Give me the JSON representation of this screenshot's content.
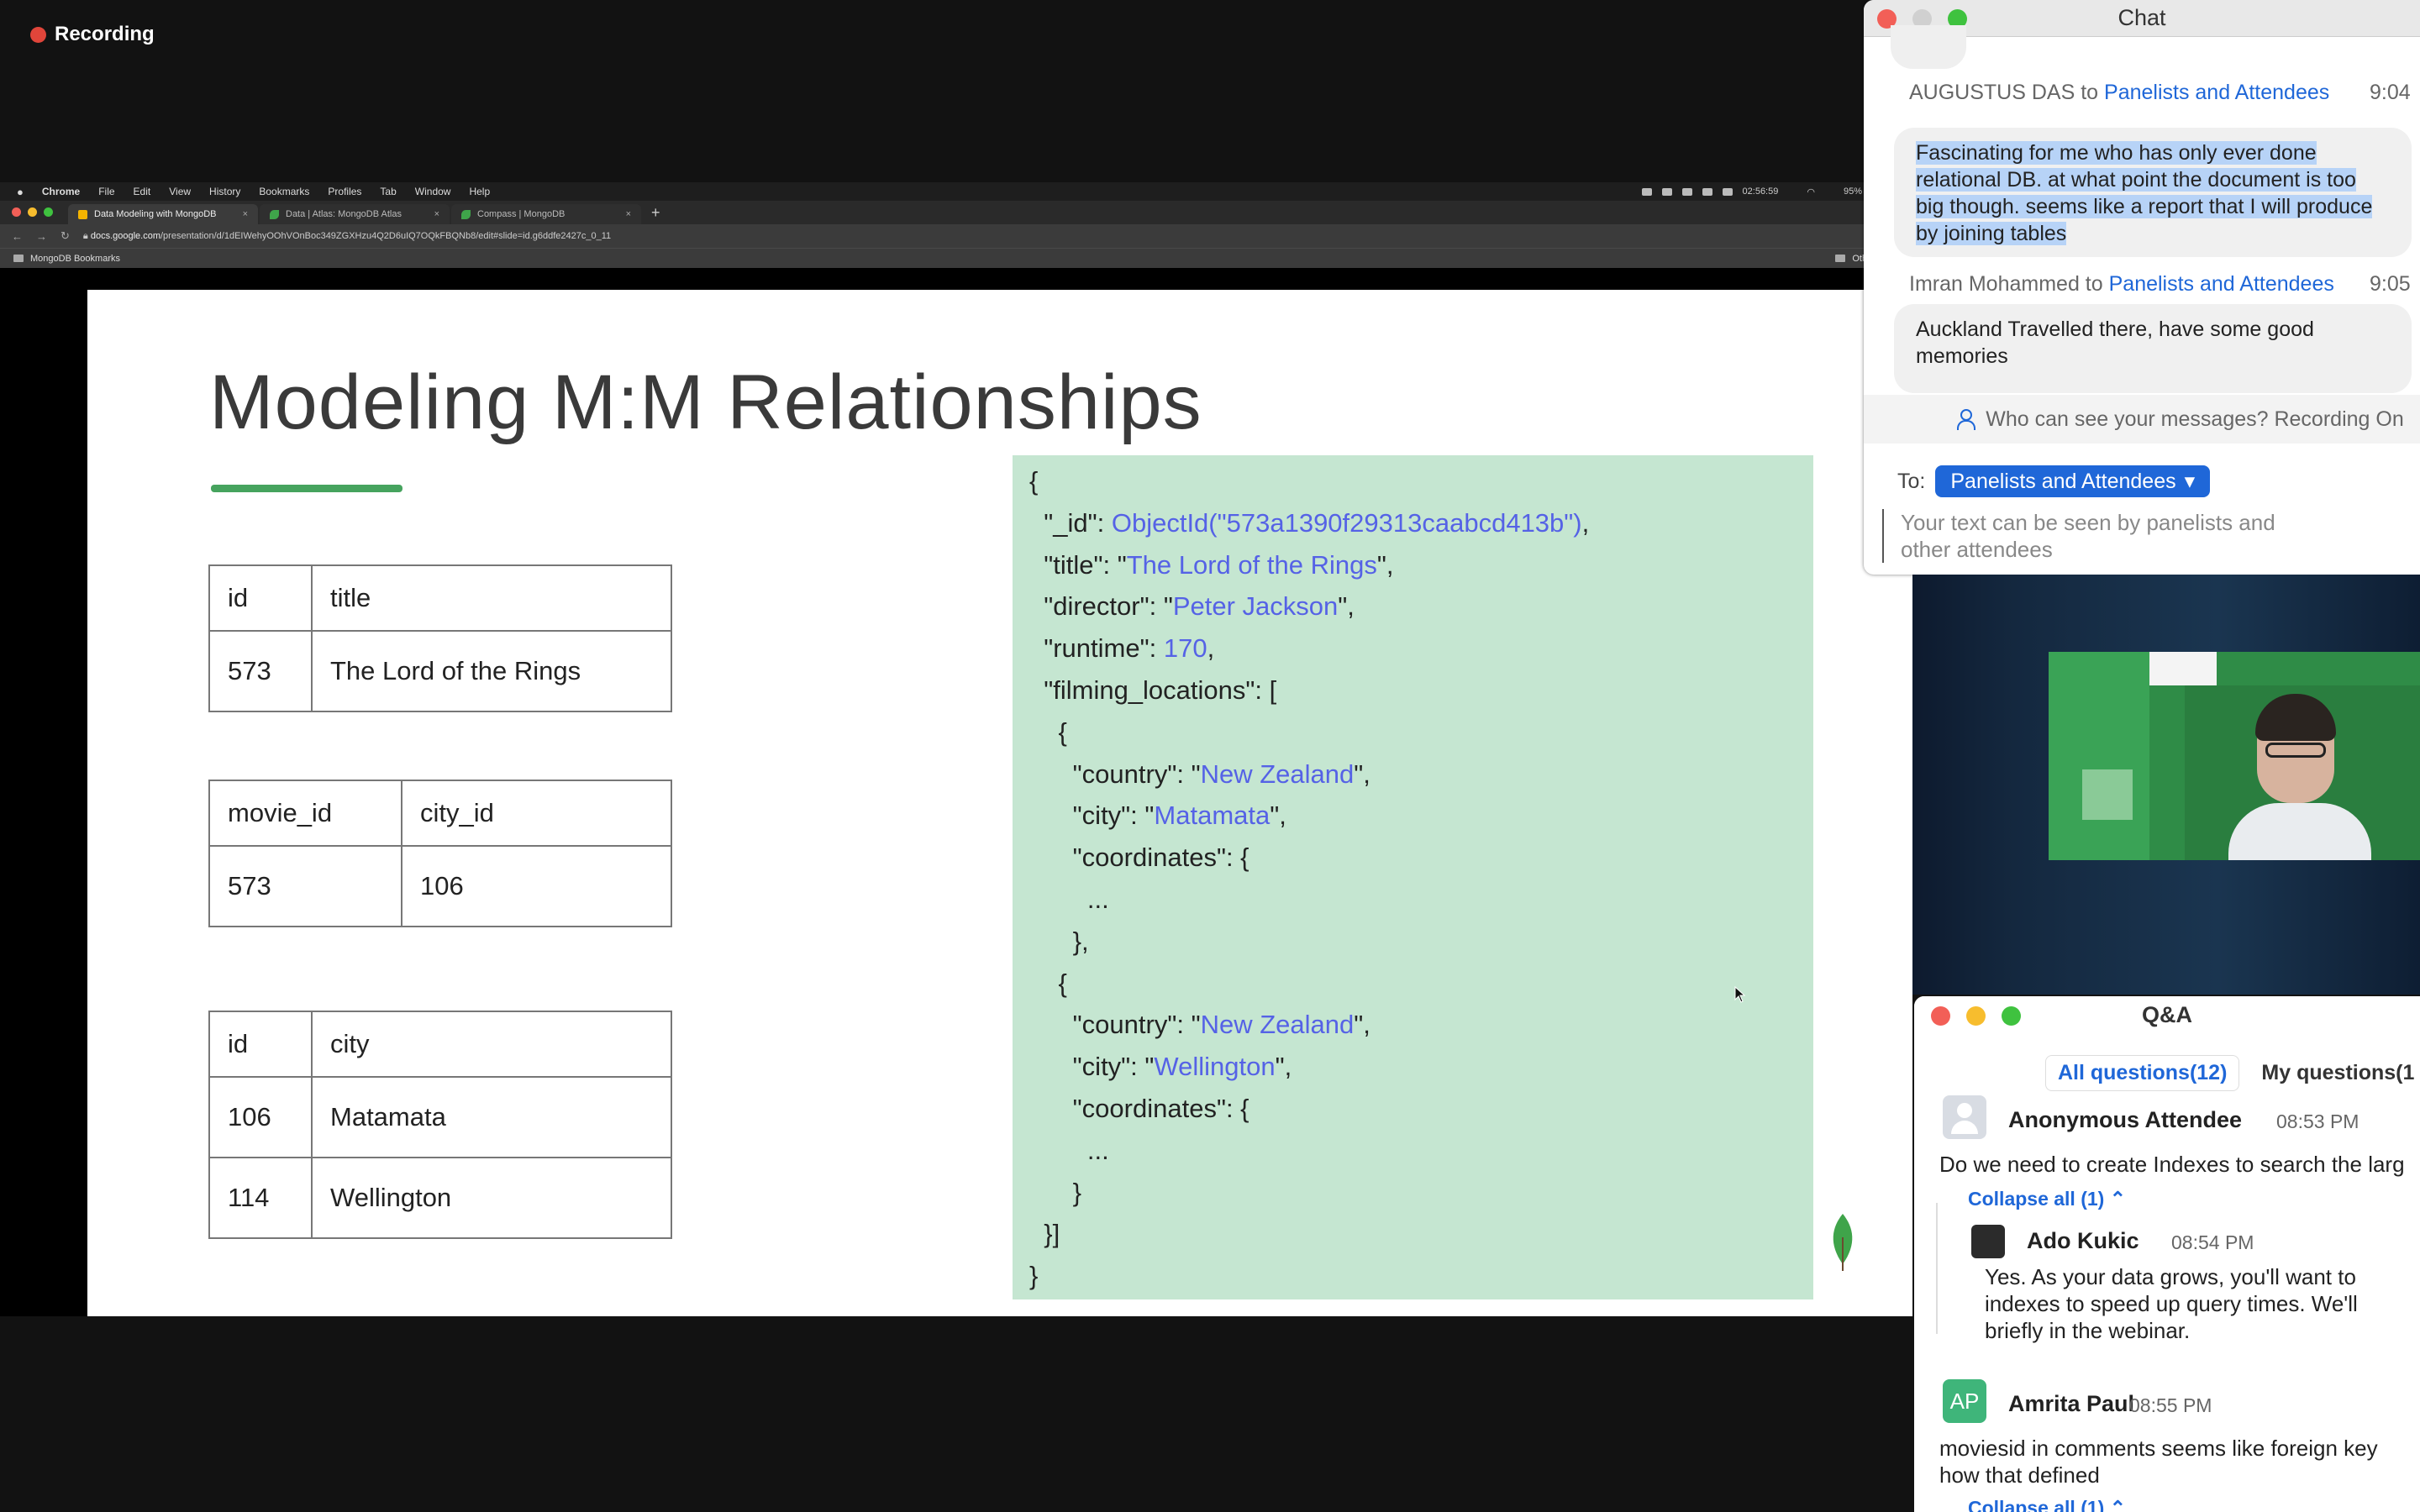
{
  "recording": {
    "label": "Recording"
  },
  "mac_menu": {
    "app": "Chrome",
    "items": [
      "File",
      "Edit",
      "View",
      "History",
      "Bookmarks",
      "Profiles",
      "Tab",
      "Window",
      "Help"
    ],
    "clock": "02:56:59",
    "battery": "95%"
  },
  "browser": {
    "tabs": [
      {
        "label": "Data Modeling with MongoDB"
      },
      {
        "label": "Data | Atlas: MongoDB Atlas"
      },
      {
        "label": "Compass | MongoDB"
      }
    ],
    "new_tab": "+",
    "url_host": "docs.google.com",
    "url_path": "/presentation/d/1dEIWehyOOhVOnBoc349ZGXHzu4Q2D6uIQ7OQkFBQNb8/edit#slide=id.g6ddfe2427c_0_11",
    "bookmark": "MongoDB Bookmarks",
    "other_bookmarks": "Other Book"
  },
  "slide": {
    "title": "Modeling M:M Relationships",
    "tables": [
      {
        "headers": [
          "id",
          "title"
        ],
        "rows": [
          [
            "573",
            "The Lord of the Rings"
          ]
        ]
      },
      {
        "headers": [
          "movie_id",
          "city_id"
        ],
        "rows": [
          [
            "573",
            "106"
          ]
        ]
      },
      {
        "headers": [
          "id",
          "city"
        ],
        "rows": [
          [
            "106",
            "Matamata"
          ],
          [
            "114",
            "Wellington"
          ]
        ]
      }
    ],
    "json": {
      "open": "{",
      "id_key": "  \"_id\": ",
      "id_val": "ObjectId(\"573a1390f29313caabcd413b\")",
      "title_key": "  \"title\": \"",
      "title_val": "The Lord of the Rings",
      "director_key": "  \"director\": \"",
      "director_val": "Peter Jackson",
      "runtime_key": "  \"runtime\": ",
      "runtime_val": "170",
      "locations_key": "  \"filming_locations\": [",
      "brace_open": "    {",
      "country_key": "      \"country\": \"",
      "country_val": "New Zealand",
      "city_key": "      \"city\": \"",
      "city1_val": "Matamata",
      "coords_key": "      \"coordinates\": {",
      "ellipsis": "        ...",
      "inner_close": "      }",
      "brace_close_comma": "    },",
      "city2_val": "Wellington",
      "brace_close": "    }",
      "array_close": "  }]",
      "close": "}"
    }
  },
  "chat": {
    "title": "Chat",
    "messages": [
      {
        "sender": "AUGUSTUS DAS",
        "to_word": " to ",
        "recipient": "Panelists and Attendees",
        "time": "9:04",
        "text": "Fascinating for me who has only ever done relational DB. at what point the document is too big though. seems like a report that I will produce by joining tables"
      },
      {
        "sender": "Imran Mohammed",
        "to_word": " to ",
        "recipient": "Panelists and Attendees",
        "time": "9:05",
        "text": "Auckland Travelled there, have some good memories"
      }
    ],
    "privacy": "Who can see your messages? Recording On",
    "to_label": "To:",
    "to_value": "Panelists and Attendees",
    "placeholder": "Your text can be seen by panelists and other attendees"
  },
  "qa": {
    "title": "Q&A",
    "tab_all": "All questions(12)",
    "tab_mine": "My questions(1",
    "items": [
      {
        "name": "Anonymous Attendee",
        "time": "08:53 PM",
        "text": "Do we need to create Indexes to search the larg",
        "collapse": "Collapse all (1)",
        "answer": {
          "name": "Ado Kukic",
          "time": "08:54 PM",
          "lines": [
            "Yes. As your data grows, you'll want to",
            "indexes to speed up query times. We'll",
            "briefly in the webinar."
          ]
        }
      },
      {
        "name": "Amrita Paul",
        "initials": "AP",
        "time": "08:55 PM",
        "lines": [
          "moviesid in comments seems like foreign key",
          "how that defined"
        ],
        "collapse": "Collapse all (1)"
      }
    ]
  },
  "colors": {
    "accent_blue": "#1f67d8",
    "json_value": "#5562e6",
    "json_bg": "#c5e6d1",
    "title_underline": "#46a35e",
    "recording_red": "#e0453a"
  }
}
